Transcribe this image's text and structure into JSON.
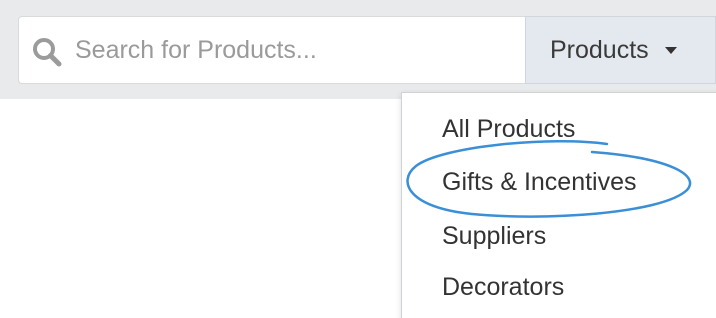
{
  "search": {
    "placeholder": "Search for Products..."
  },
  "products_button": {
    "label": "Products"
  },
  "dropdown": {
    "items": [
      {
        "label": "All Products"
      },
      {
        "label": "Gifts & Incentives"
      },
      {
        "label": "Suppliers"
      },
      {
        "label": "Decorators"
      }
    ]
  },
  "icons": {
    "search": "search-icon",
    "caret": "caret-down-icon"
  },
  "colors": {
    "highlight_annotation": "#3a8fd6",
    "products_button_bg": "#e4e8ef",
    "top_band_bg": "#e9eaec"
  }
}
